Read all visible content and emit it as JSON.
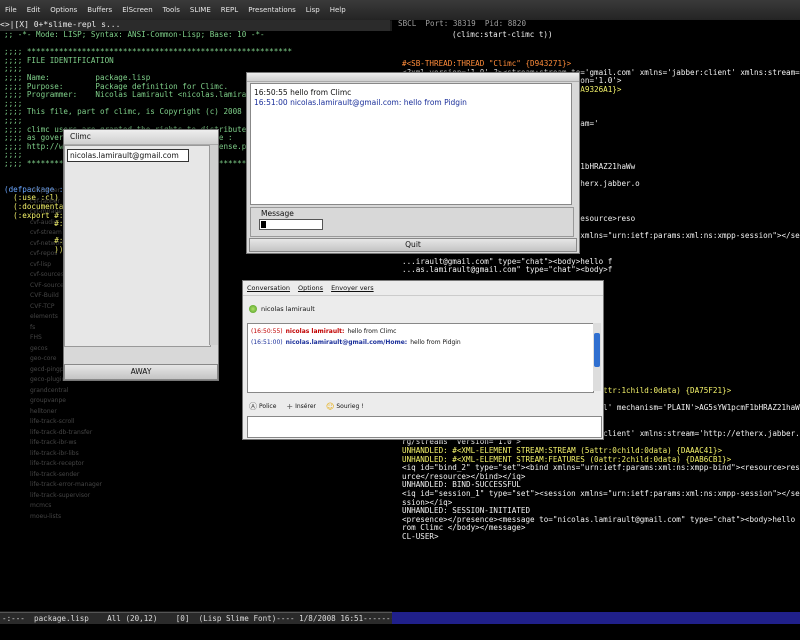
{
  "menu": [
    "File",
    "Edit",
    "Options",
    "Buffers",
    "ElScreen",
    "Tools",
    "SLIME",
    "REPL",
    "Presentations",
    "Lisp",
    "Help"
  ],
  "tabbar": "<>|[X] 0+*slime-repl s...",
  "left_lines": [
    ";; -*- Mode: LISP; Syntax: ANSI-Common-Lisp; Base: 10 -*-",
    "",
    ";;;; **********************************************************",
    ";;;; FILE IDENTIFICATION",
    ";;;;",
    ";;;; Name:          package.lisp",
    ";;;; Purpose:       Package definition for Climc.",
    ";;;; Programmer:    Nicolas Lamirault <nicolas.lamirault@gmail.com>",
    ";;;;",
    ";;;; This file, part of climc, is Copyright (c) 2008 by",
    ";;;;",
    ";;;; climc users are granted the rights to distribute and use this software",
    ";;;; as governed by the terms of the MIT License :",
    ";;;; http://www.opensource.org/licenses/mit-license.php",
    ";;;;",
    ";;;; **********************************************************",
    "",
    "",
    "(defpackage :climc",
    "  (:use :cl)",
    "  (:documentation \"A Jabber client.\")",
    "  (:export #:climc",
    "           #:",
    "",
    "           #:",
    "           ))"
  ],
  "ghost_items": [
    "cvf-parser",
    "cvf-jabber",
    "cvf-mirage",
    "cvf-audio",
    "cvf-stream",
    "cvf-network",
    "cvf-repos",
    "cvf-lisp",
    "cvf-sources",
    "CVF-source",
    "CVF-Build",
    "CVF-TCP",
    "elements",
    "fs",
    "FHS",
    "gecos",
    "geo-core",
    "gecd-pingping-plugin",
    "geco-plugin",
    "grandcentral",
    "groupvanpe",
    "helltoner",
    "life-track-scroll",
    "life-track-db-transfer",
    "life-track-ibr-ws",
    "life-track-ibr-libs",
    "life-track-receptor",
    "life-track-sender",
    "life-track-error-manager",
    "life-track-supervisor",
    "mcmcs",
    "moeu-lists"
  ],
  "left_modeline": "-:---  package.lisp    All (20,12)    [0]  (Lisp Slime Font)---- 1/8/2008 16:51--------",
  "repl": {
    "header": "SBCL  Port: 38319  Pid: 8820",
    "call": "(climc:start-climc t))",
    "lines": [
      [
        "orange",
        "#<SB-THREAD:THREAD \"Climc\" {D943271}>"
      ],
      [
        "white",
        "<?xml version='1.0' ?><stream:stream to='gmail.com' xmlns='jabber:client' xmlns:stream='"
      ],
      [
        "white",
        "http://etherx.jabber.org/streams' version='1.0'>"
      ],
      [
        "yellow",
        "...STREAM:STREAM (5attr:0child:0data) {A9326A1}>"
      ],
      [
        "yellow",
        "...S (0attr:2child:0data) {A9359E9}>"
      ],
      [
        "white",
        "xmpp-tls'/>"
      ],
      [
        "yellow",
        "...0child:0data) {A93A4B9}>"
      ],
      [
        "white",
        "...om' xmlns='jabber:client' xmlns:stream='"
      ],
      [
        "white",
        "...'1.0'>"
      ],
      [
        "yellow",
        "...5attr:0child:0data) {A956C89}>"
      ],
      [
        "yellow",
        "...:2child:0data) {A95DF21}>"
      ],
      [
        "white",
        ""
      ],
      [
        "white",
        "...-sasl' mechanism='PLAIN'>AG5sYW1pcmF1bHRAZ21haWw"
      ],
      [
        "white",
        ""
      ],
      [
        "white",
        "...bber:client' xmlns:stream='http://etherx.jabber.o"
      ],
      [
        "white",
        ""
      ],
      [
        "yellow",
        "...5attr:0child:0data) {A97FC09}>"
      ],
      [
        "yellow",
        "...:2child:0data) {A985C89}>"
      ],
      [
        "white",
        "...urn:ietf:params:xml:ns:xmpp-bind\"><resource>reso"
      ],
      [
        "white",
        "UNHANDLED: BIND-SUCCESSFUL"
      ],
      [
        "white",
        "<iq id=\"session_1\" type=\"set\"><session xmlns=\"urn:ietf:params:xml:ns:xmpp-session\"></se"
      ],
      [
        "white",
        "ssion></iq>"
      ],
      [
        "white",
        ""
      ],
      [
        "white",
        "...irault@gmail.com\" type=\"chat\"><body>hello f"
      ],
      [
        "white",
        "...as.lamirault@gmail.com\" type=\"chat\"><body>f"
      ],
      [
        "white",
        ""
      ],
      [
        "white",
        ""
      ],
      [
        "white",
        "output*))"
      ],
      [
        "white",
        ""
      ],
      [
        "white",
        ""
      ],
      [
        "white",
        "...irault@gmail.com' xmlns:stream='"
      ],
      [
        "white",
        ""
      ],
      [
        "yellow",
        "...0data) {D4B6411}>"
      ],
      [
        "yellow",
        "...0data) {D4AE989}>"
      ],
      [
        "white",
        "...tls'/>"
      ],
      [
        "yellow",
        "...0data) {D453179}>"
      ],
      [
        "white",
        "...com' xmlns='jabber:client' xmlns:stream='"
      ],
      [
        "yellow",
        "...0data) {D46EC89}>"
      ],
      [
        "yellow",
        "UNHANDLED: #<XML-ELEMENT STREAM:FEATURES (0attr:1child:0data) {DA75F21}>"
      ],
      [
        "white",
        "SASL state: START"
      ],
      [
        "white",
        "<auth xmlns='urn:ietf:params:xml:ns:xmpp-sasl' mechanism='PLAIN'>AG5sYW1pcmF1bHRAZ21haWw"
      ],
      [
        "white",
        "uY29tADIxUGVyQHZ1MDU=</auth>"
      ],
      [
        "white",
        "UNHANDLED: AUTHENTICATION-SUCCESSFUL"
      ],
      [
        "white",
        "<stream:stream to='gmail.com' xmlns='jabber:client' xmlns:stream='http://etherx.jabber.o"
      ],
      [
        "white",
        "rg/streams' version='1.0'>"
      ],
      [
        "yellow",
        "UNHANDLED: #<XML-ELEMENT STREAM:STREAM (5attr:0child:0data) {DAAAC41}>"
      ],
      [
        "yellow",
        "UNHANDLED: #<XML-ELEMENT STREAM:FEATURES (0attr:2child:0data) {DAB6CB1}>"
      ],
      [
        "white",
        "<iq id=\"bind_2\" type=\"set\"><bind xmlns=\"urn:ietf:params:xml:ns:xmpp-bind\"><resource>reso"
      ],
      [
        "white",
        "urce</resource></bind></iq>"
      ],
      [
        "white",
        "UNHANDLED: BIND-SUCCESSFUL"
      ],
      [
        "white",
        "<iq id=\"session_1\" type=\"set\"><session xmlns=\"urn:ietf:params:xml:ns:xmpp-session\"></se"
      ],
      [
        "white",
        "ssion></iq>"
      ],
      [
        "white",
        "UNHANDLED: SESSION-INITIATED"
      ],
      [
        "white",
        "<presence></presence><message to=\"nicolas.lamirault@gmail.com\" type=\"chat\"><body>hello f"
      ],
      [
        "white",
        "rom Climc </body></message>"
      ],
      [
        "white",
        "CL-USER>"
      ]
    ]
  },
  "climc_window": {
    "title": "Climc",
    "entry": "nicolas.lamirault@gmail.com",
    "status_button": "AWAY"
  },
  "chat_window": {
    "messages": [
      "16:50:55 hello from Climc",
      "16:51:00 nicolas.lamirault@gmail.com: hello from Pidgin"
    ],
    "message_label": "Message",
    "quit_button": "Quit"
  },
  "pidgin": {
    "menu": [
      "Conversation",
      "Options",
      "Envoyer vers"
    ],
    "buddy": "nicolas lamirault",
    "log": [
      {
        "time": "(16:50:55)",
        "who": "nicolas lamirault:",
        "text": "hello from Climc",
        "who_color": "#c00000"
      },
      {
        "time": "(16:51:00)",
        "who": "nicolas.lamirault@gmail.com/Home:",
        "text": "hello from Pidgin",
        "who_color": "#1a2f9a"
      }
    ],
    "toolbar": [
      "Police",
      "Insérer",
      "Sourieg !"
    ]
  }
}
